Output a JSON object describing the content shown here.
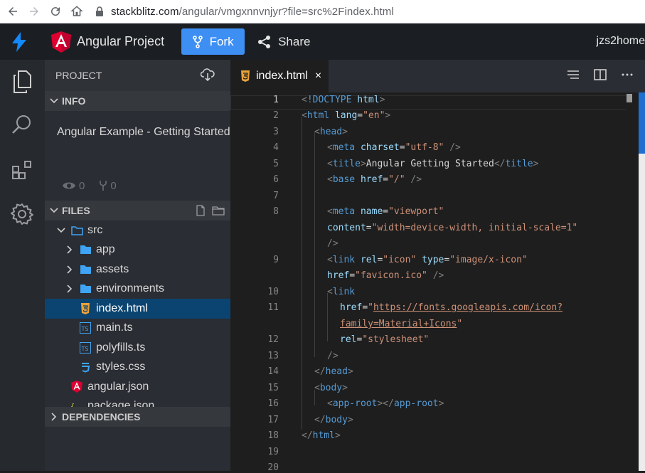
{
  "browser": {
    "url_host": "stackblitz.com",
    "url_path": "/angular/vmgxnnvnjyr?file=src%2Findex.html"
  },
  "header": {
    "project_title": "Angular Project",
    "fork_label": "Fork",
    "share_label": "Share",
    "user": "jzs2home",
    "accent": "#3e8ff4"
  },
  "sidebar": {
    "project_label": "PROJECT",
    "info_label": "INFO",
    "info_title": "Angular Example - Getting Started",
    "views": "0",
    "forks": "0",
    "files_label": "FILES",
    "dependencies_label": "DEPENDENCIES",
    "tree": [
      {
        "name": "src",
        "icon": "folder-outline-icon",
        "expanded": true
      },
      {
        "name": "app",
        "icon": "folder-icon"
      },
      {
        "name": "assets",
        "icon": "folder-icon"
      },
      {
        "name": "environments",
        "icon": "folder-icon"
      },
      {
        "name": "index.html",
        "icon": "html5-icon",
        "active": true
      },
      {
        "name": "main.ts",
        "icon": "typescript-icon"
      },
      {
        "name": "polyfills.ts",
        "icon": "typescript-icon"
      },
      {
        "name": "styles.css",
        "icon": "css3-icon"
      },
      {
        "name": "angular.json",
        "icon": "angular-icon"
      },
      {
        "name": "package.json",
        "icon": "json-braces-icon"
      }
    ]
  },
  "editor": {
    "tab_label": "index.html",
    "tab_close": "×",
    "line_numbers": [
      "1",
      "2",
      "3",
      "4",
      "5",
      "6",
      "7",
      "8",
      "9",
      "10",
      "11",
      "12",
      "13",
      "14",
      "15",
      "16",
      "17",
      "18",
      "19",
      "20"
    ]
  }
}
